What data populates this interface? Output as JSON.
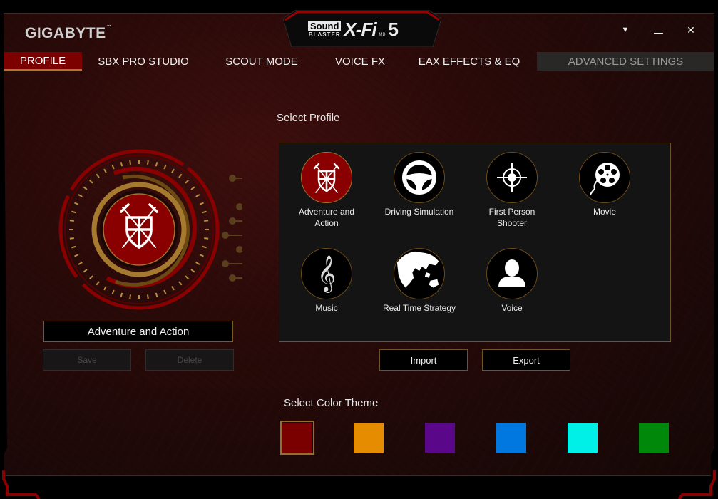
{
  "window": {
    "brand": "GIGABYTE",
    "brand_tm": "™",
    "product_logo": {
      "sound": "Sound",
      "blaster": "BLΔSTER",
      "xfi": "X-Fi",
      "mb": "MB",
      "version": "5"
    },
    "controls": {
      "menu": "▼",
      "minimize": "—",
      "close": "✕"
    }
  },
  "tabs": [
    {
      "label": "PROFILE",
      "active": true
    },
    {
      "label": "SBX PRO STUDIO",
      "active": false
    },
    {
      "label": "SCOUT MODE",
      "active": false
    },
    {
      "label": "VOICE FX",
      "active": false
    },
    {
      "label": "EAX EFFECTS & EQ",
      "active": false
    },
    {
      "label": "ADVANCED SETTINGS",
      "active": false,
      "dimmed": true
    }
  ],
  "current_profile": {
    "name": "Adventure and Action",
    "save_label": "Save",
    "delete_label": "Delete"
  },
  "select_profile": {
    "title": "Select Profile",
    "profiles": [
      {
        "label": "Adventure and Action",
        "icon": "shield-swords-icon",
        "selected": true
      },
      {
        "label": "Driving Simulation",
        "icon": "steering-wheel-icon",
        "selected": false
      },
      {
        "label": "First Person Shooter",
        "icon": "crosshair-icon",
        "selected": false
      },
      {
        "label": "Movie",
        "icon": "film-reel-icon",
        "selected": false
      },
      {
        "label": "Music",
        "icon": "treble-clef-icon",
        "selected": false
      },
      {
        "label": "Real Time Strategy",
        "icon": "world-map-icon",
        "selected": false
      },
      {
        "label": "Voice",
        "icon": "person-icon",
        "selected": false
      }
    ],
    "import_label": "Import",
    "export_label": "Export"
  },
  "color_theme": {
    "title": "Select Color Theme",
    "swatches": [
      {
        "name": "red",
        "color": "#7a0000",
        "selected": true
      },
      {
        "name": "orange",
        "color": "#e58c00",
        "selected": false
      },
      {
        "name": "purple",
        "color": "#5a078a",
        "selected": false
      },
      {
        "name": "blue",
        "color": "#0078e0",
        "selected": false
      },
      {
        "name": "cyan",
        "color": "#00efe6",
        "selected": false
      },
      {
        "name": "green",
        "color": "#00880a",
        "selected": false
      }
    ]
  },
  "theme_colors": {
    "accent": "#7c0000",
    "gold": "#a67a2e"
  }
}
